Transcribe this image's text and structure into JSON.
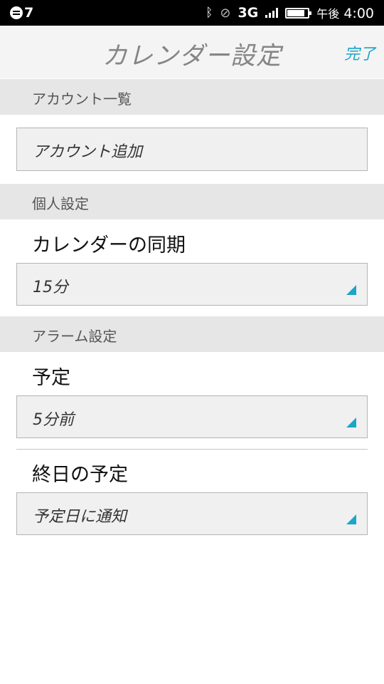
{
  "status_bar": {
    "notification_count": "7",
    "network": "3G",
    "ampm": "午後",
    "time": "4:00"
  },
  "header": {
    "title": "カレンダー設定",
    "done_label": "完了"
  },
  "accounts_section": {
    "header": "アカウント一覧",
    "add_account_label": "アカウント追加"
  },
  "personal_section": {
    "header": "個人設定",
    "sync_label": "カレンダーの同期",
    "sync_value": "15分"
  },
  "alarm_section": {
    "header": "アラーム設定",
    "event_label": "予定",
    "event_value": "5分前",
    "allday_label": "終日の予定",
    "allday_value": "予定日に通知"
  },
  "colors": {
    "accent": "#1aa6c8",
    "section_header_bg": "#e6e6e6",
    "title_bar_bg": "#f4f4f4"
  }
}
